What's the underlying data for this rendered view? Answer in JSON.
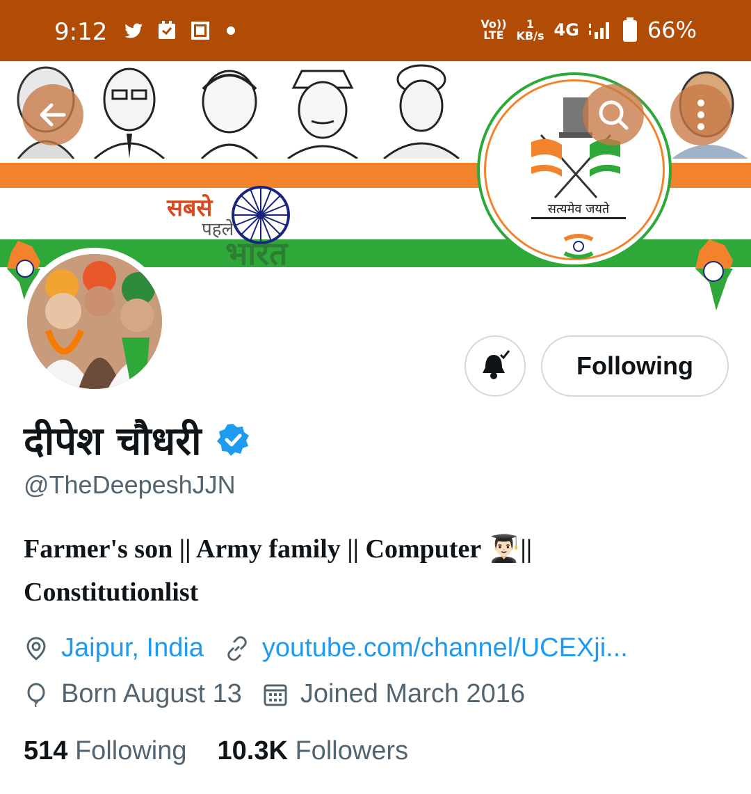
{
  "status_bar": {
    "time": "9:12",
    "volte": "Vo)) LTE",
    "net_speed_value": "1",
    "net_speed_unit": "KB/s",
    "network": "4G",
    "battery": "66%"
  },
  "banner": {
    "slogan_line1": "सबसे",
    "slogan_line2": "पहले",
    "slogan_line3": "भारत",
    "emblem_motto": "सत्यमेव जयते",
    "colors": {
      "saffron": "#f2832c",
      "green": "#2fa83a"
    }
  },
  "profile": {
    "name": "दीपेश चौधरी",
    "handle": "@TheDeepeshJJN",
    "bio_line1": "Farmer's son || Army family || Computer 👨🏻‍🎓||",
    "bio_line2": "Constitutionlist",
    "location": "Jaipur, India",
    "website": "youtube.com/channel/UCEXji...",
    "birthday": "Born August 13",
    "joined": "Joined March 2016",
    "following_count": "514",
    "following_label": "Following",
    "followers_count": "10.3K",
    "followers_label": "Followers"
  },
  "actions": {
    "follow_state_label": "Following"
  },
  "icons": {
    "back": "back-arrow-icon",
    "search": "search-icon",
    "more": "more-vertical-icon",
    "notify": "bell-check-icon",
    "verified": "verified-badge-icon",
    "location": "location-pin-icon",
    "link": "link-icon",
    "birthday": "balloon-icon",
    "calendar": "calendar-icon"
  },
  "colors": {
    "accent": "#1d9bf0",
    "status_bar": "#b04c06",
    "muted": "#536471"
  }
}
